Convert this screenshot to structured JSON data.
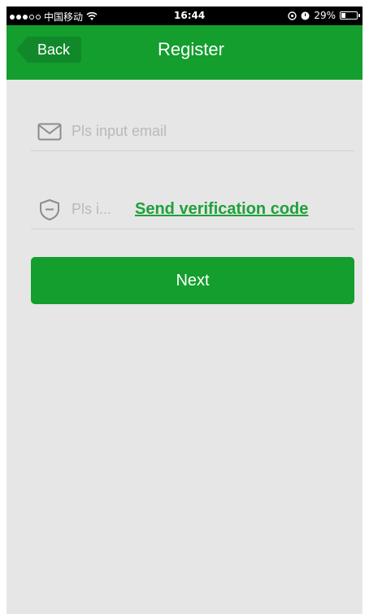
{
  "status_bar": {
    "carrier": "中国移动",
    "time": "16:44",
    "battery_text": "29%",
    "battery_level": 0.29
  },
  "nav": {
    "back_label": "Back",
    "title": "Register"
  },
  "form": {
    "email_placeholder": "Pls input email",
    "email_value": "",
    "code_placeholder": "Pls i...",
    "code_value": "",
    "send_code_label": "Send verification code"
  },
  "next_label": "Next",
  "colors": {
    "brand_green": "#139e2d",
    "link_green": "#1ea13a",
    "background": "#e6e6e6"
  }
}
